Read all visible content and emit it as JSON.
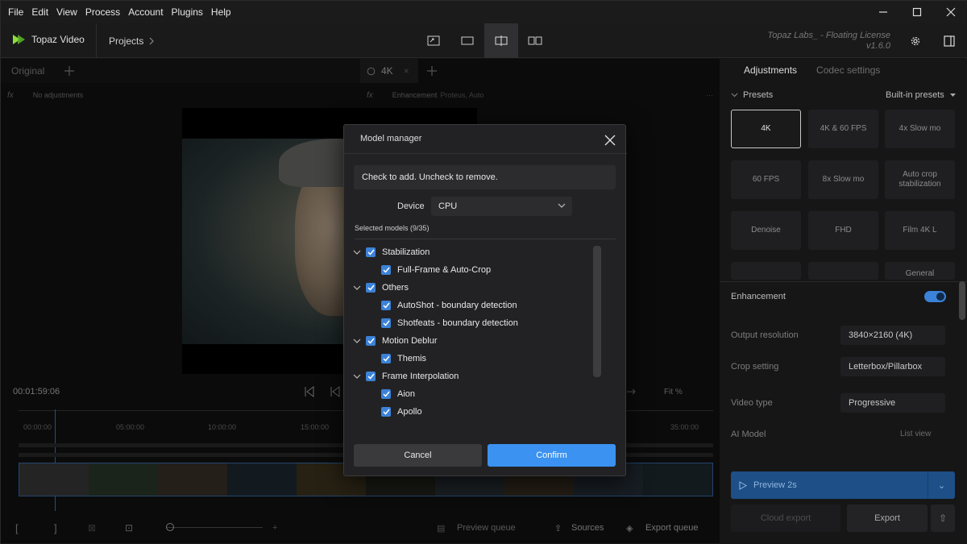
{
  "menu": [
    "File",
    "Edit",
    "View",
    "Process",
    "Account",
    "Plugins",
    "Help"
  ],
  "toolbar": {
    "app_name": "Topaz Video",
    "projects_label": "Projects",
    "license_line1": "Topaz Labs_ - Floating License",
    "license_version": "v1.6.0"
  },
  "left_panel": {
    "original_tab": "Original",
    "fx_text": "No adjustments",
    "timecode": "00:01:59:06",
    "ticks": [
      "00:00:00",
      "05:00:00",
      "10:00:00",
      "15:00:00",
      "35:00:00"
    ]
  },
  "center_panel": {
    "tab_label": "4K",
    "enhancement_label": "Enhancement",
    "enhancement_value": "Proteus, Auto",
    "fit_label": "Fit %"
  },
  "bottom": {
    "preview_queue": "Preview queue",
    "sources": "Sources",
    "export_queue": "Export queue"
  },
  "right_panel": {
    "tab_adjustments": "Adjustments",
    "tab_codec": "Codec settings",
    "presets_label": "Presets",
    "presets_dropdown": "Built-in presets",
    "presets": [
      "4K",
      "4K & 60 FPS",
      "4x Slow mo",
      "60 FPS",
      "8x Slow mo",
      "Auto crop stabilization",
      "Denoise",
      "FHD",
      "Film 4K L",
      "",
      "",
      "General"
    ],
    "enhancement_label": "Enhancement",
    "output_resolution_label": "Output resolution",
    "output_resolution_value": "3840×2160 (4K)",
    "crop_label": "Crop setting",
    "crop_value": "Letterbox/Pillarbox",
    "video_type_label": "Video type",
    "video_type_value": "Progressive",
    "ai_model_label": "AI Model",
    "list_view": "List view",
    "preview_button": "Preview 2s",
    "cloud_export": "Cloud export",
    "export": "Export"
  },
  "modal": {
    "title": "Model manager",
    "info": "Check to add. Uncheck to remove.",
    "device_label": "Device",
    "device_value": "CPU",
    "selected_count": "Selected models (9/35)",
    "items": [
      {
        "label": "Stabilization",
        "level": 0,
        "checked": true
      },
      {
        "label": "Full-Frame & Auto-Crop",
        "level": 1,
        "checked": true
      },
      {
        "label": "Others",
        "level": 0,
        "checked": true
      },
      {
        "label": "AutoShot - boundary detection",
        "level": 1,
        "checked": true
      },
      {
        "label": "Shotfeats - boundary detection",
        "level": 1,
        "checked": true
      },
      {
        "label": "Motion Deblur",
        "level": 0,
        "checked": true
      },
      {
        "label": "Themis",
        "level": 1,
        "checked": true
      },
      {
        "label": "Frame Interpolation",
        "level": 0,
        "checked": true
      },
      {
        "label": "Aion",
        "level": 1,
        "checked": true
      },
      {
        "label": "Apollo",
        "level": 1,
        "checked": true
      }
    ],
    "cancel": "Cancel",
    "confirm": "Confirm"
  },
  "colors": {
    "accent": "#3b92f0",
    "checkbox": "#3b82d8",
    "toggle": "#3b82d8"
  }
}
